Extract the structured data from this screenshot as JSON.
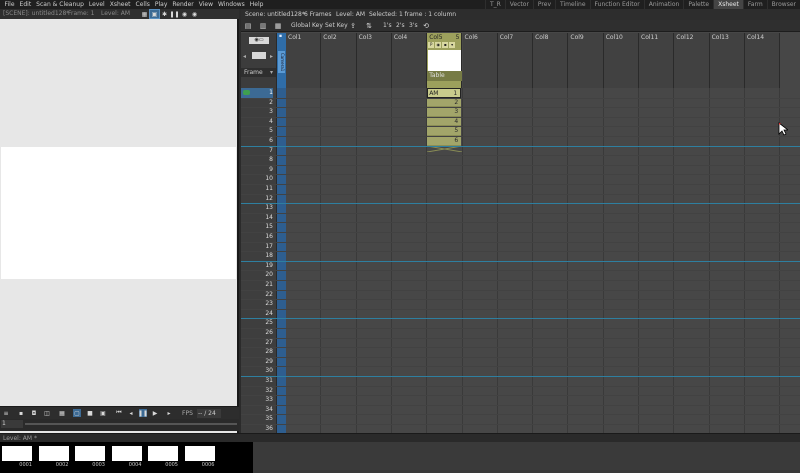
{
  "menu": [
    "File",
    "Edit",
    "Scan & Cleanup",
    "Level",
    "Xsheet",
    "Cells",
    "Play",
    "Render",
    "View",
    "Windows",
    "Help"
  ],
  "rooms": [
    "T_R",
    "Vector",
    "Prev",
    "Timeline",
    "Function Editor",
    "Animation",
    "Palette",
    "Xsheet",
    "Farm",
    "Browser"
  ],
  "active_room": "Xsheet",
  "viewer": {
    "scene": "[SCENE]: untitled128*",
    "frame": "Frame: 1",
    "level": "Level: AM",
    "fps_label": "FPS",
    "fps_value": "-- / 24",
    "current_frame": "1"
  },
  "xsheet": {
    "status": {
      "scene": "Scene: untitled128*",
      "frames": "6 Frames",
      "level": "Level: AM",
      "selected": "Selected: 1 frame : 1 column"
    },
    "toolbar": {
      "global_key": "Global Key",
      "set_key": "Set Key",
      "step1": "1's",
      "step2": "2's",
      "step3": "3's"
    },
    "frame_header": "Frame",
    "camera_label": "Camera1",
    "columns": [
      "Col1",
      "Col2",
      "Col3",
      "Col4",
      "Col5",
      "Col6",
      "Col7",
      "Col8",
      "Col9",
      "Col10",
      "Col11",
      "Col12",
      "Col13",
      "Col14"
    ],
    "selected_column": "Col5",
    "selected_column_count": "5",
    "pegbar": "Table",
    "cell_level": "AM",
    "cell_frames": [
      "1",
      "2",
      "3",
      "4",
      "5",
      "6"
    ],
    "rows": [
      "1",
      "2",
      "3",
      "4",
      "5",
      "6",
      "7",
      "8",
      "9",
      "10",
      "11",
      "12",
      "13",
      "14",
      "15",
      "16",
      "17",
      "18",
      "19",
      "20",
      "21",
      "22",
      "23",
      "24",
      "25",
      "26",
      "27",
      "28",
      "29",
      "30",
      "31",
      "32",
      "33",
      "34",
      "35",
      "36"
    ],
    "current_row": "1"
  },
  "level_strip": {
    "title": "Level: AM *",
    "frames": [
      "0001",
      "0002",
      "0003",
      "0004",
      "0005",
      "0006"
    ]
  },
  "colors": {
    "accent": "#3c6a94",
    "column_selected": "#9ca05c",
    "cell_fill": "#a2a56a",
    "marker_line": "#2e7fa0"
  }
}
